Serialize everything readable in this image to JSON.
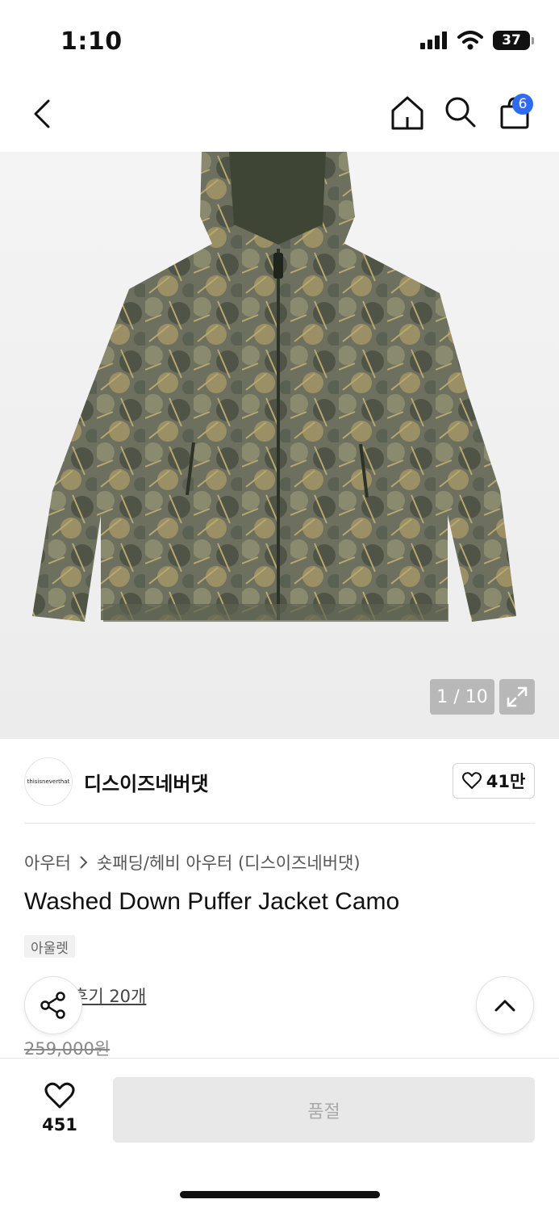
{
  "status_bar": {
    "time": "1:10",
    "battery": "37"
  },
  "nav": {
    "cart_count": "6"
  },
  "gallery": {
    "counter": "1 / 10"
  },
  "brand": {
    "logo_text": "thisisneverthat",
    "name": "디스이즈네버댓",
    "likes": "41만"
  },
  "breadcrumb": {
    "level1": "아우터",
    "level2": "숏패딩/헤비 아우터 (디스이즈네버댓)"
  },
  "product": {
    "title": "Washed Down Puffer Jacket Camo",
    "tag": "아울렛",
    "review_link": "후기 20개",
    "original_price": "259,000원"
  },
  "bottom_bar": {
    "wish_count": "451",
    "buy_label": "품절"
  },
  "colors": {
    "accent": "#2f6bf0",
    "soldout_bg": "#e8e8e8"
  }
}
